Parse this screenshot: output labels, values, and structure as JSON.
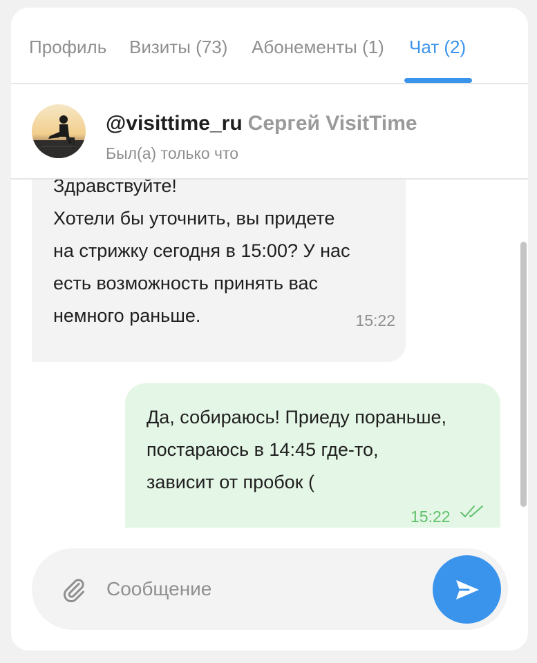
{
  "tabs": [
    {
      "label": "Профиль",
      "active": false
    },
    {
      "label": "Визиты (73)",
      "active": false
    },
    {
      "label": "Абонементы (1)",
      "active": false
    },
    {
      "label": "Чат (2)",
      "active": true
    }
  ],
  "chat_header": {
    "username": "@visittime_ru",
    "full_name": "Сергей VisitTime",
    "status": "Был(а) только что",
    "avatar_icon": "user-photo"
  },
  "messages": [
    {
      "direction": "incoming",
      "lines": [
        "Здравствуйте!",
        "Хотели бы уточнить, вы придете",
        "на стрижку сегодня в 15:00? У нас",
        "есть возможность принять вас",
        "немного раньше."
      ],
      "time": "15:22"
    },
    {
      "direction": "outgoing",
      "lines": [
        "Да, собираюсь! Приеду пораньше,",
        "постараюсь в 14:45 где-то,",
        "зависит от пробок ("
      ],
      "time": "15:22",
      "status_icon": "double-check-icon"
    }
  ],
  "composer": {
    "placeholder": "Сообщение",
    "value": "",
    "attach_icon": "paperclip-icon",
    "send_icon": "send-icon"
  },
  "colors": {
    "accent": "#3b94ec",
    "incoming_bubble": "#f3f3f3",
    "outgoing_bubble": "#e4f6e6",
    "read_check": "#5fc16a"
  }
}
